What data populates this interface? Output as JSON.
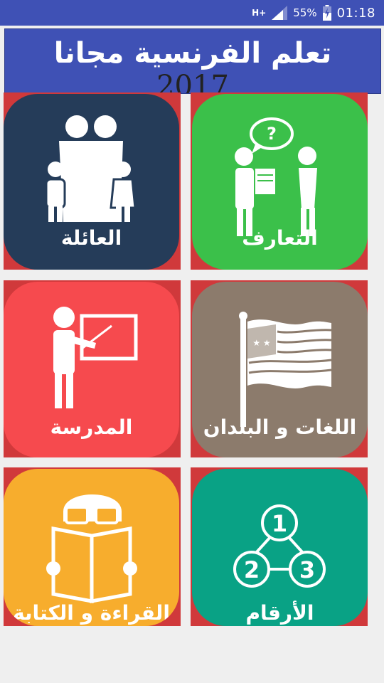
{
  "status_bar": {
    "network": "H+",
    "battery_percent": "55%",
    "time": "01:18"
  },
  "header": {
    "title": "تعلم الفرنسية مجانا",
    "year": "2017"
  },
  "tiles": [
    {
      "label": "التعارف",
      "color": "#3bc04a",
      "icon": "conversation-icon"
    },
    {
      "label": "العائلة",
      "color": "#253c59",
      "icon": "family-icon"
    },
    {
      "label": "اللغات و البلدان",
      "color": "#8c7b6c",
      "icon": "flag-icon"
    },
    {
      "label": "المدرسة",
      "color": "#f64a4e",
      "icon": "teacher-icon"
    },
    {
      "label": "الأرقام",
      "color": "#09a285",
      "icon": "numbers-icon"
    },
    {
      "label": "القراءة و الكتابة",
      "color": "#f7ad2d",
      "icon": "reading-icon"
    }
  ],
  "numbers_icon_digits": [
    "1",
    "2",
    "3"
  ],
  "colors": {
    "accent": "#3f51b5",
    "cell_background": "#d0393b"
  }
}
